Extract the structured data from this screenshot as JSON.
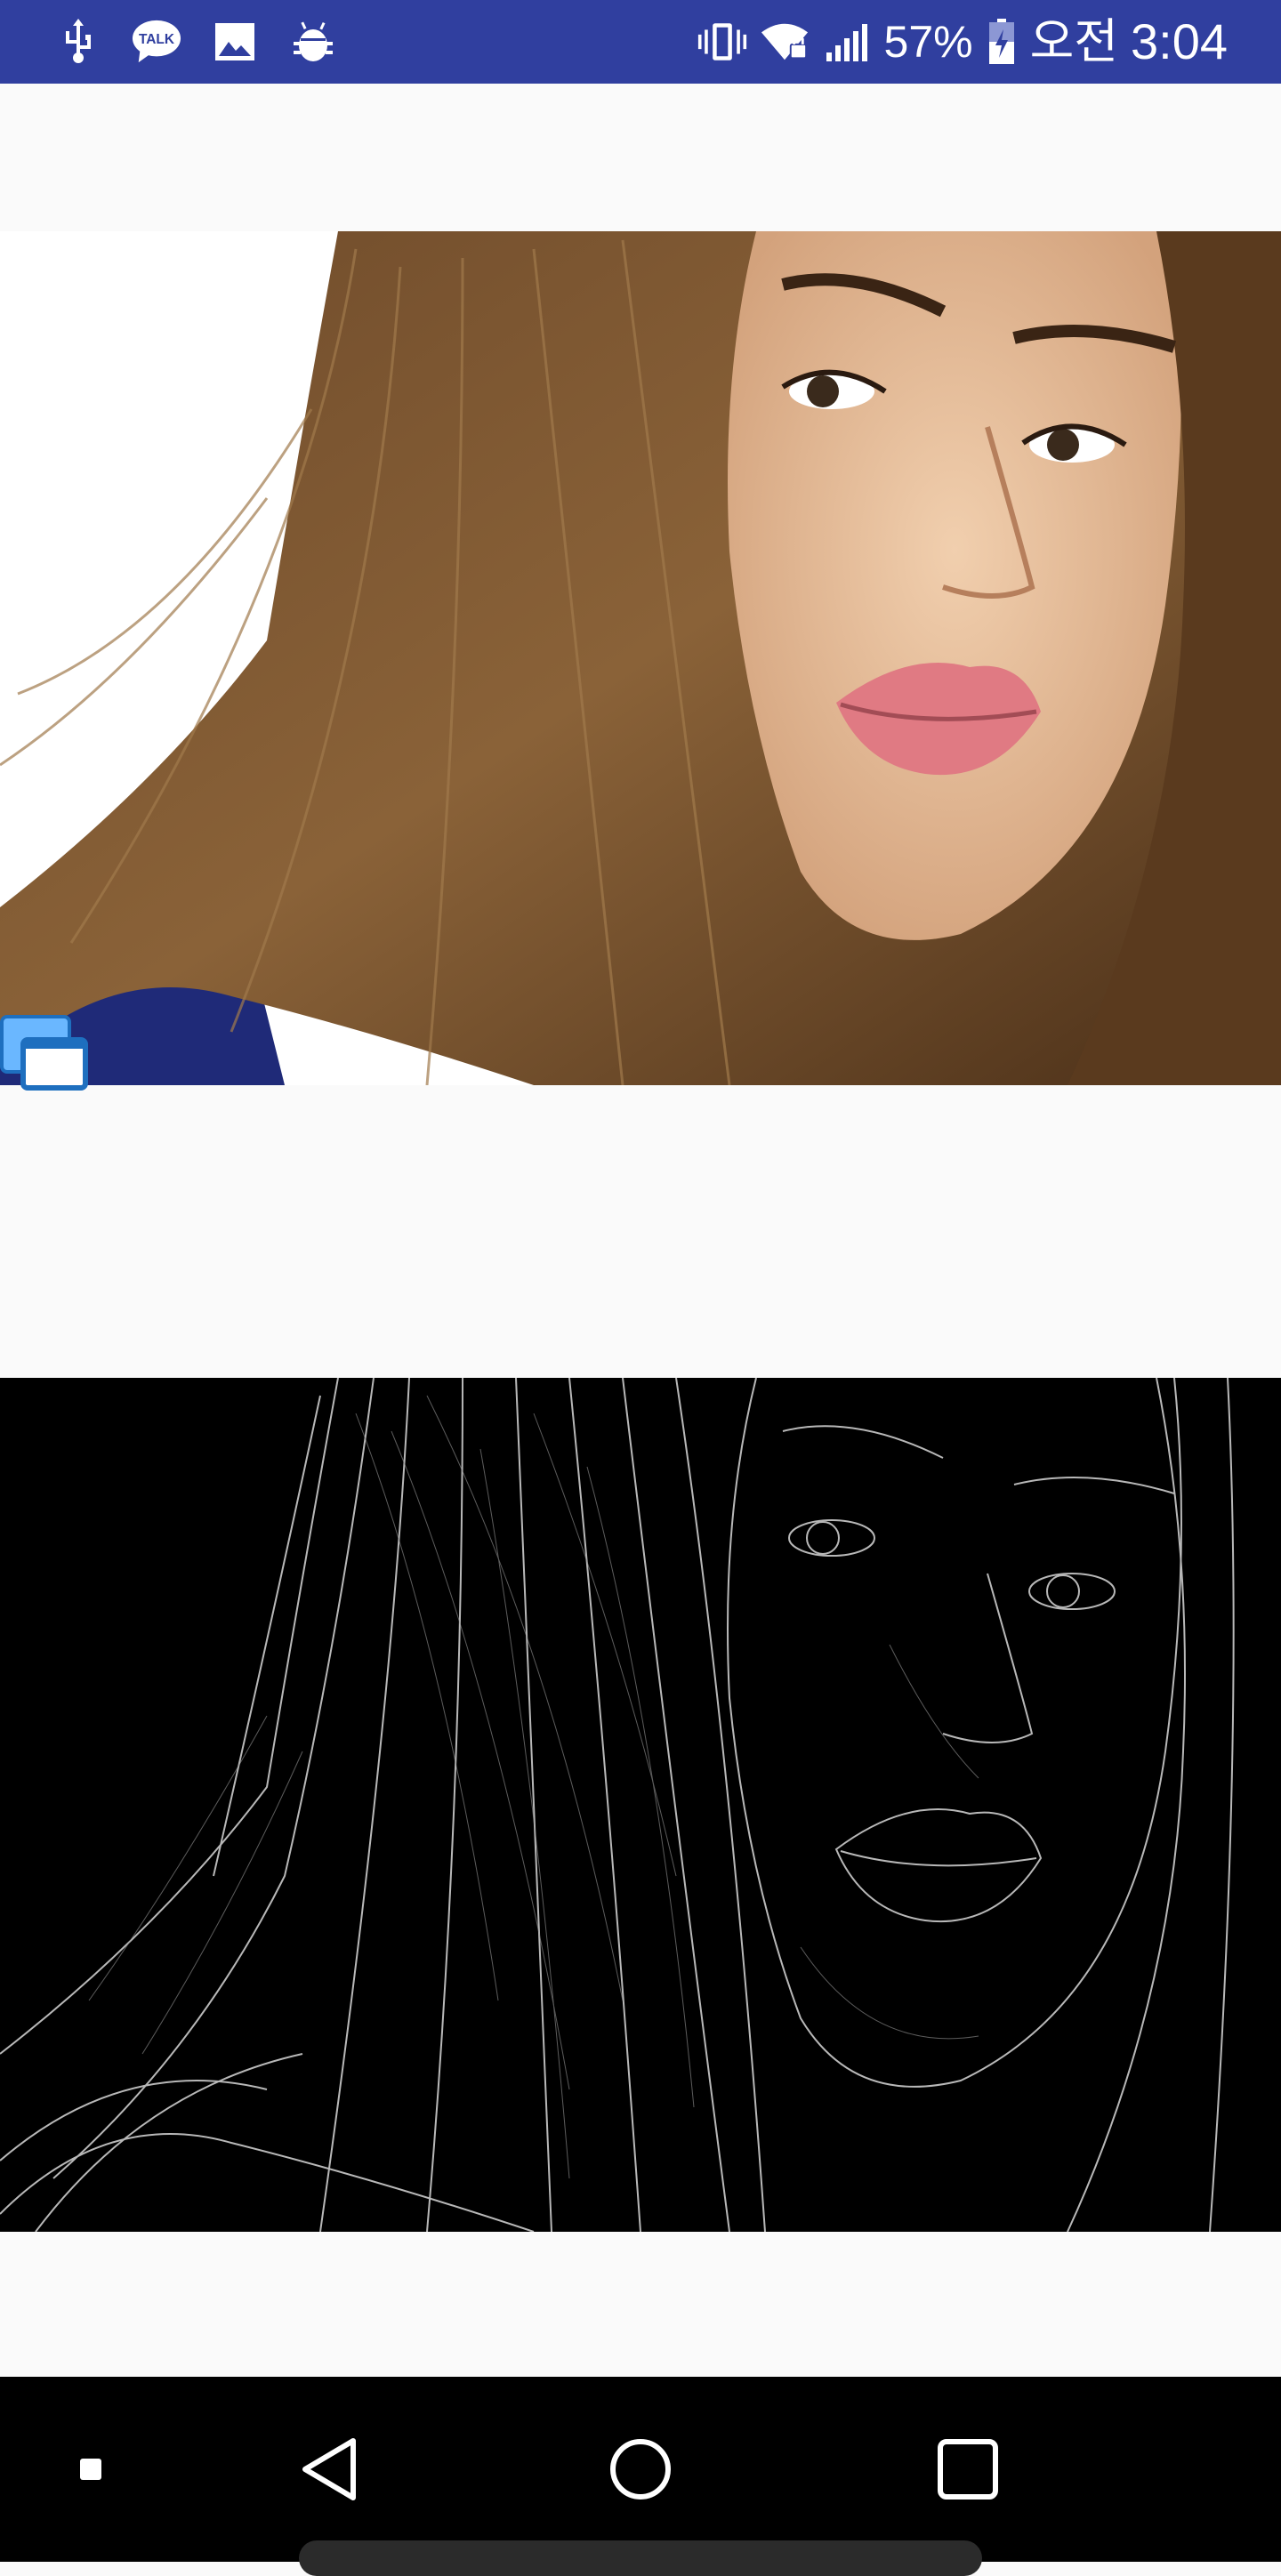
{
  "status_bar": {
    "battery_percent": "57%",
    "am_pm": "오전",
    "time": "3:04",
    "left_icons": [
      "usb-icon",
      "kakaotalk-icon",
      "gallery-icon",
      "android-debug-icon"
    ],
    "right_icons": [
      "vibrate-icon",
      "wifi-icon",
      "signal-icon",
      "battery-charging-icon"
    ],
    "kakaotalk_label": "TALK",
    "background_color": "#303f9f"
  },
  "main": {
    "original_image": {
      "description_icon": "portrait-photo"
    },
    "edge_image": {
      "description_icon": "canny-edge-output"
    },
    "overlay_icon": "multi-window-icon"
  },
  "nav_bar": {
    "buttons": [
      "recent-dot-icon",
      "back-icon",
      "home-icon",
      "overview-icon"
    ]
  }
}
